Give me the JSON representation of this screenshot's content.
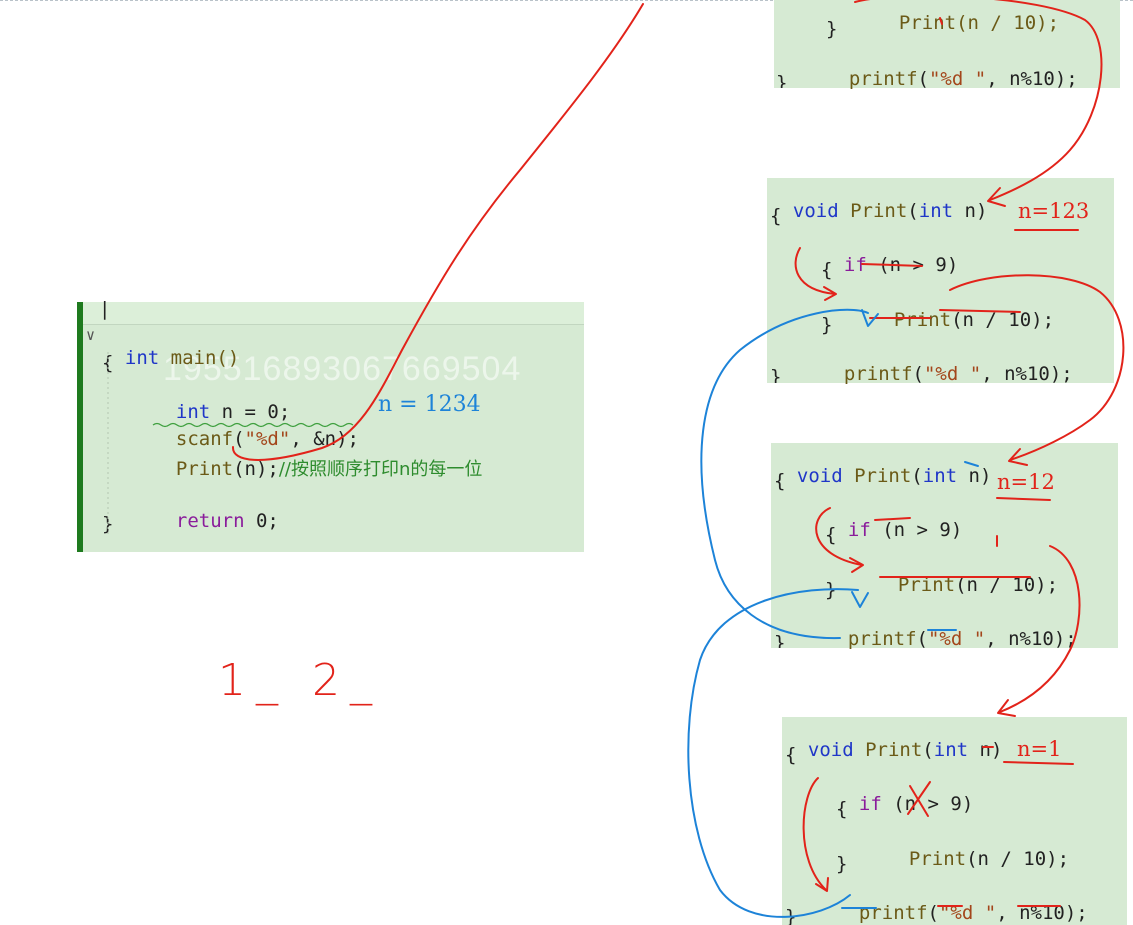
{
  "main_editor": {
    "caret": "|",
    "fold_marker": "∨",
    "watermark": "195516893067669504",
    "lines": {
      "l1_kw": "int",
      "l1_fn": " main()",
      "l2": "{",
      "l3_kw": "int",
      "l3_rest": " n = 0;",
      "l4_fn": "scanf",
      "l4_a": "(",
      "l4_str": "\"%d\"",
      "l4_rest": ", &n);",
      "l5_fn": "Print",
      "l5_rest": "(n);",
      "l5_comment": "//按照顺序打印n的每一位",
      "l6_kw": "return",
      "l6_rest": " 0;",
      "l7": "}"
    },
    "annotation": "n = 1234"
  },
  "output_sketch": "1_ 2_",
  "frames": [
    {
      "note": "",
      "lines": {
        "partial": "Print(n / 10);",
        "close": "}",
        "printf_fn": "printf",
        "printf_a": "(",
        "printf_str": "\"%d \"",
        "printf_rest": ", n%10);",
        "tail": "}"
      }
    },
    {
      "note": "n=123",
      "lines": {
        "sig_kw": "void",
        "sig_fn": " Print",
        "sig_a": "(",
        "sig_kw2": "int",
        "sig_rest": " n)",
        "open": "{",
        "if_kw": "if",
        "if_rest": " (n > 9)",
        "brace_open": "{",
        "call_fn": "Print",
        "call_rest": "(n / 10);",
        "brace_close": "}",
        "printf_fn": "printf",
        "printf_a": "(",
        "printf_str": "\"%d \"",
        "printf_rest": ", n%10);",
        "close": "}"
      }
    },
    {
      "note": "n=12",
      "lines": {
        "sig_kw": "void",
        "sig_fn": " Print",
        "sig_a": "(",
        "sig_kw2": "int",
        "sig_rest": " n)",
        "open": "{",
        "if_kw": "if",
        "if_rest": " (n > 9)",
        "brace_open": "{",
        "call_fn": "Print",
        "call_rest": "(n / 10);",
        "brace_close": "}",
        "printf_fn": "printf",
        "printf_a": "(",
        "printf_str": "\"%d \"",
        "printf_rest": ", n%10);",
        "close": "}"
      }
    },
    {
      "note": "n=1",
      "lines": {
        "sig_kw": "void",
        "sig_fn": " Print",
        "sig_a": "(",
        "sig_kw2": "int",
        "sig_rest": " n)",
        "open": "{",
        "if_kw": "if",
        "if_rest": " (n > 9)",
        "brace_open": "{",
        "call_fn": "Print",
        "call_rest": "(n / 10);",
        "brace_close": "}",
        "printf_fn": "printf",
        "printf_a": "(",
        "printf_str": "\"%d \"",
        "printf_rest": ", n%10);",
        "close": "}"
      }
    }
  ],
  "colors": {
    "panel_bg": "#d6ead3",
    "gutter_bar": "#1e7a1e",
    "ink_red": "#e2231a",
    "ink_blue": "#1d83d8",
    "keyword": "#1f36c8",
    "keyword_control": "#8a1c9b",
    "function": "#6b5a17",
    "string": "#a3461b",
    "comment": "#2e8c2e"
  }
}
